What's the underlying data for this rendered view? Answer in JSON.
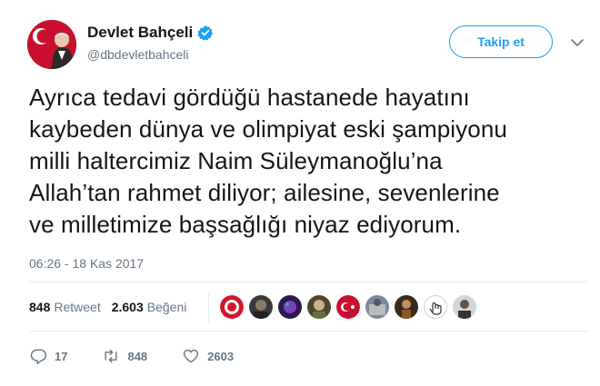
{
  "author": {
    "name": "Devlet Bahçeli",
    "handle": "@dbdevletbahceli",
    "verified_color": "#1da1f2",
    "avatar_icon": "profile-photo"
  },
  "follow_button": {
    "label": "Takip et"
  },
  "tweet": {
    "text": "Ayrıca tedavi gördüğü hastanede hayatını\nkaybeden dünya ve olimpiyat eski şampiyonu\nmilli haltercimiz Naim Süleymanoğlu’na\nAllah’tan rahmet diliyor; ailesine, sevenlerine\nve milletimize başsağlığı niyaz ediyorum.",
    "timestamp": "06:26 - 18 Kas 2017"
  },
  "stats": {
    "retweet_count": "848",
    "retweet_label": "Retweet",
    "like_count": "2.603",
    "like_label": "Beğeni"
  },
  "actions": {
    "reply_count": "17",
    "retweet_count": "848",
    "like_count": "2603"
  },
  "colors": {
    "accent": "#1da1f2",
    "muted": "#657786",
    "text": "#14171a"
  }
}
